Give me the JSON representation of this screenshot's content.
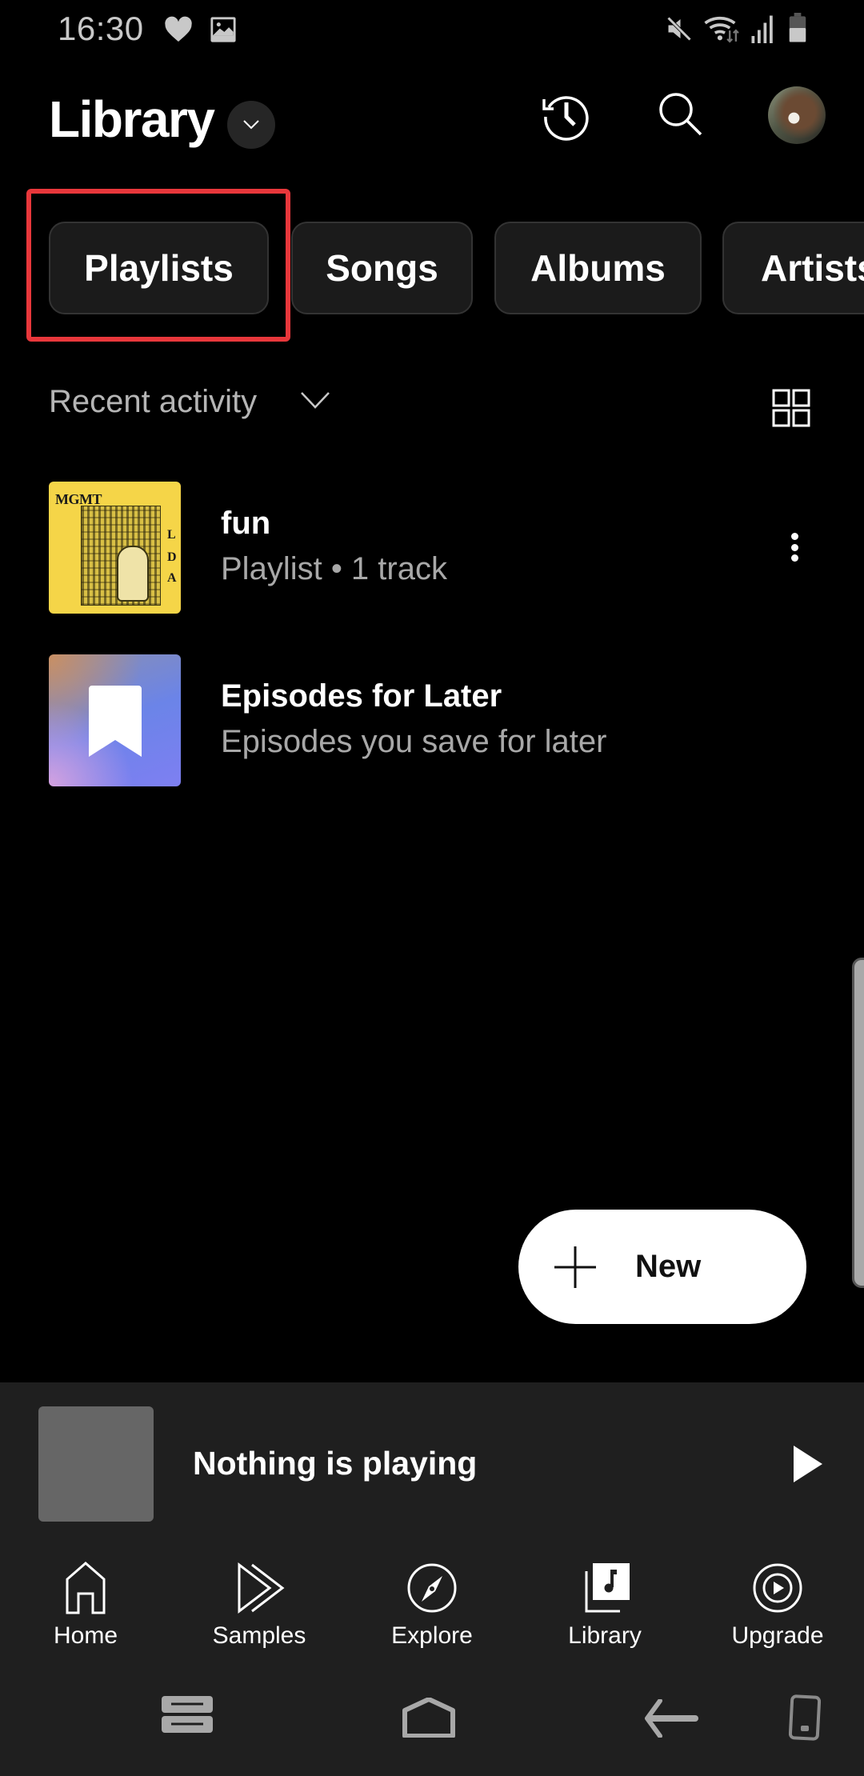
{
  "status_bar": {
    "time": "16:30",
    "left_icons": [
      "heart-icon",
      "image-icon"
    ],
    "right_icons": [
      "mute-icon",
      "wifi-icon",
      "signal-icon",
      "battery-icon"
    ]
  },
  "header": {
    "title": "Library",
    "dropdown_icon": "chevron-down-icon",
    "actions": [
      "history-icon",
      "search-icon",
      "avatar"
    ]
  },
  "tabs": [
    {
      "label": "Playlists",
      "selected": true
    },
    {
      "label": "Songs"
    },
    {
      "label": "Albums"
    },
    {
      "label": "Artists"
    }
  ],
  "sort": {
    "label": "Recent activity",
    "view_toggle": "grid-icon"
  },
  "items": [
    {
      "title": "fun",
      "subtitle": "Playlist • 1 track",
      "thumb_band": "MGMT",
      "thumb_side": [
        "L",
        "D",
        "A"
      ],
      "has_menu": true
    },
    {
      "title": "Episodes for Later",
      "subtitle": "Episodes you save for later",
      "thumb_icon": "bookmark-icon"
    }
  ],
  "fab": {
    "label": "New",
    "icon": "plus-icon"
  },
  "player": {
    "title": "Nothing is playing",
    "action_icon": "play-icon"
  },
  "bottom_nav": [
    {
      "label": "Home",
      "icon": "home-icon"
    },
    {
      "label": "Samples",
      "icon": "samples-icon"
    },
    {
      "label": "Explore",
      "icon": "compass-icon"
    },
    {
      "label": "Library",
      "icon": "library-icon",
      "active": true
    },
    {
      "label": "Upgrade",
      "icon": "upgrade-icon"
    }
  ],
  "colors": {
    "background": "#000000",
    "chip_bg": "#1b1b1b",
    "player_bg": "#1f1f1f",
    "highlight": "#e8373b",
    "fab_bg": "#ffffff"
  }
}
